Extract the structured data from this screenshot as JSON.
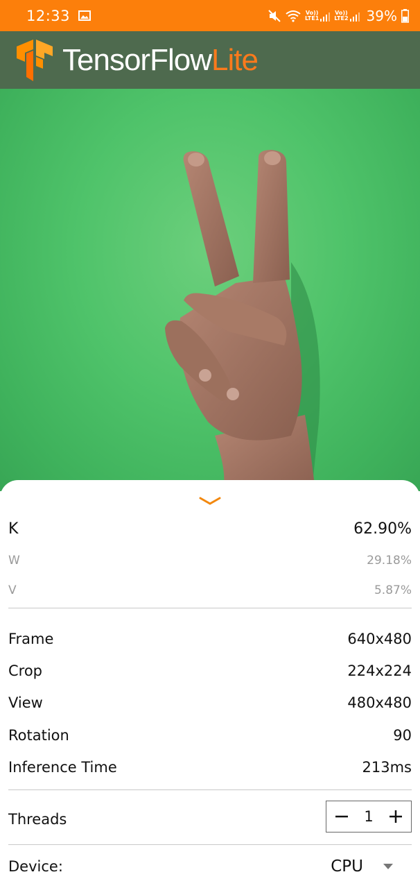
{
  "status_bar": {
    "time": "12:33",
    "lte1": "LTE1",
    "lte2": "LTE2",
    "volte": "Vo))",
    "battery": "39%"
  },
  "app_bar": {
    "title_main": "TensorFlow",
    "title_accent": "Lite",
    "colors": {
      "background": "#4e6a4e",
      "accent": "#fa7a1c",
      "logo": "#ff8f00"
    }
  },
  "camera": {
    "background_color": "#4fc36a"
  },
  "results": [
    {
      "label": "K",
      "score": "62.90%"
    },
    {
      "label": "W",
      "score": "29.18%"
    },
    {
      "label": "V",
      "score": "5.87%"
    }
  ],
  "info": {
    "frame_label": "Frame",
    "frame_value": "640x480",
    "crop_label": "Crop",
    "crop_value": "224x224",
    "view_label": "View",
    "view_value": "480x480",
    "rotation_label": "Rotation",
    "rotation_value": "90",
    "inference_label": "Inference Time",
    "inference_value": "213ms"
  },
  "threads": {
    "label": "Threads",
    "value": "1"
  },
  "device": {
    "label": "Device:",
    "value": "CPU"
  }
}
